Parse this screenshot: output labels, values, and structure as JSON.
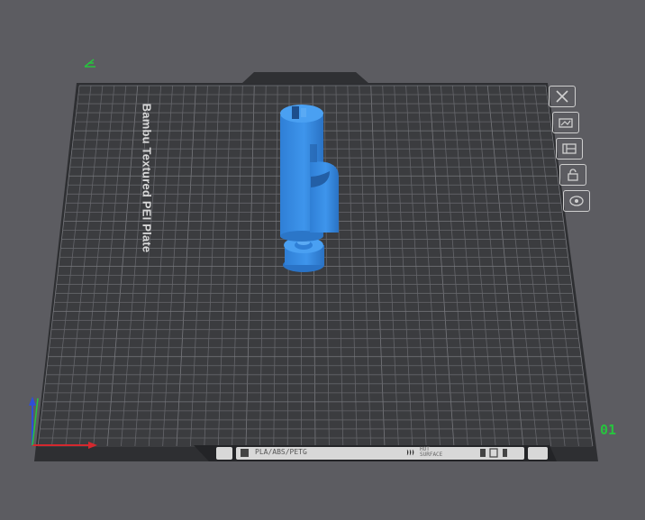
{
  "plate": {
    "name": "Bambu Textured PEI Plate",
    "number": "01",
    "label_filament": "PLA/ABS/PETG",
    "label_hot_line1": "HOT",
    "label_hot_line2": "SURFACE"
  },
  "toolbar": {
    "items": [
      {
        "icon": "close-icon"
      },
      {
        "icon": "auto-orient-icon"
      },
      {
        "icon": "arrange-icon"
      },
      {
        "icon": "lock-icon"
      },
      {
        "icon": "plate-settings-icon"
      }
    ]
  },
  "colors": {
    "background": "#5c5c61",
    "plate": "#3b3c3f",
    "grid": "#6a6b70",
    "model": "#3a8ee6",
    "axis_x": "#d4282e",
    "axis_y": "#27c43e",
    "axis_z": "#2f4fd6"
  }
}
